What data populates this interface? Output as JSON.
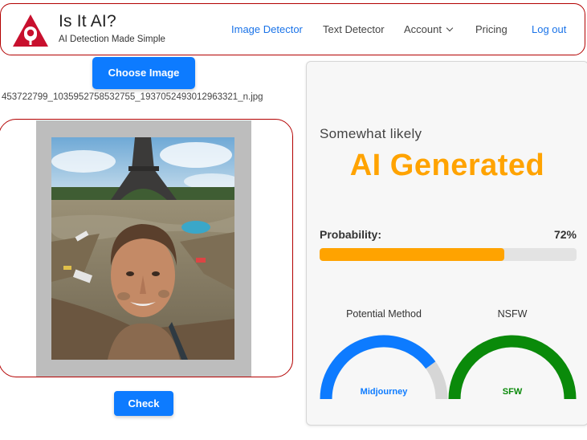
{
  "brand": {
    "title": "Is It AI?",
    "subtitle": "AI Detection Made Simple"
  },
  "nav": {
    "image_detector": "Image Detector",
    "text_detector": "Text Detector",
    "account": "Account",
    "pricing": "Pricing",
    "logout": "Log out"
  },
  "upload": {
    "choose_label": "Choose Image",
    "filename": "453722799_1035952758532755_1937052493012963321_n.jpg",
    "check_label": "Check"
  },
  "result": {
    "likelihood": "Somewhat likely",
    "verdict": "AI Generated",
    "probability_label": "Probability:",
    "probability_text": "72%",
    "probability_value": 0.72,
    "method_title": "Potential Method",
    "method_value": "Midjourney",
    "method_fraction": 0.8,
    "nsfw_title": "NSFW",
    "nsfw_value": "SFW",
    "nsfw_fraction": 1.0
  },
  "colors": {
    "accent_blue": "#0d7bff",
    "verdict_orange": "#ffa300",
    "brand_red": "#b30000",
    "sfw_green": "#0a8a0a"
  },
  "icons": [
    "robot-logo-icon",
    "chevron-down-icon"
  ]
}
